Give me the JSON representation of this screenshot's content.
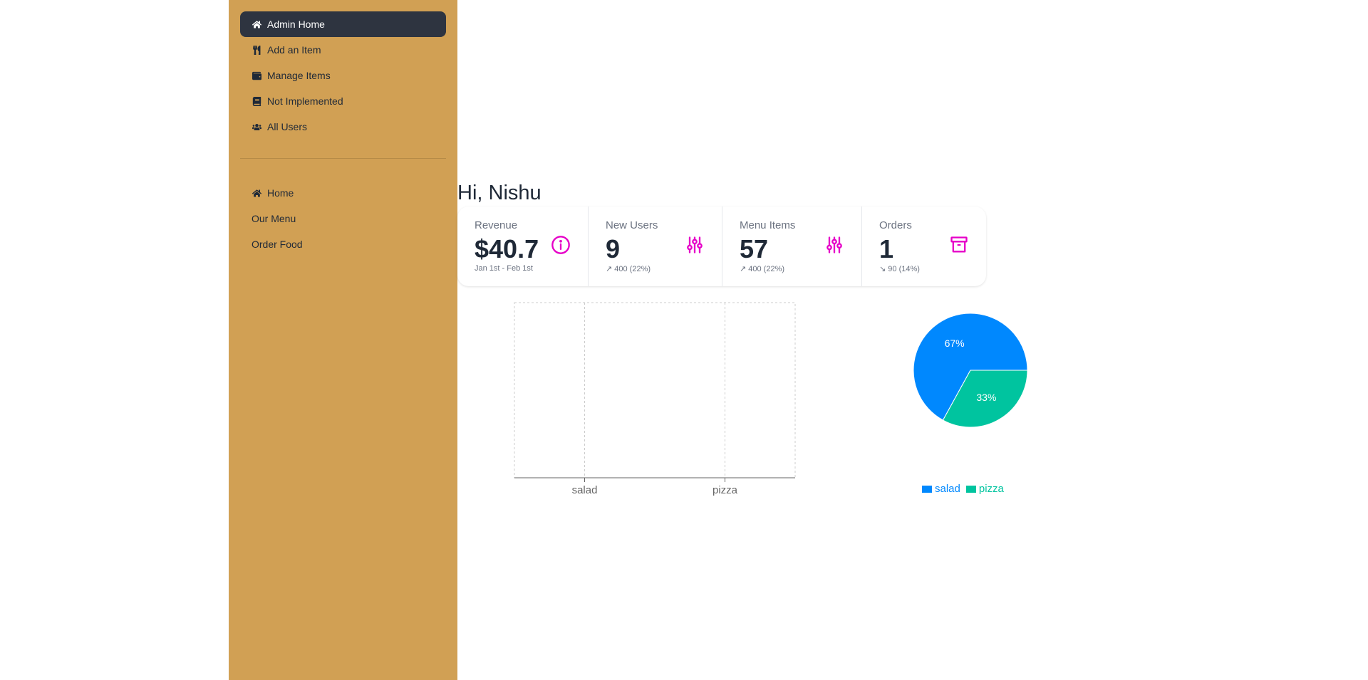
{
  "sidebar": {
    "admin_items": [
      {
        "label": "Admin Home",
        "icon": "home-icon",
        "active": true
      },
      {
        "label": "Add an Item",
        "icon": "utensils-icon",
        "active": false
      },
      {
        "label": "Manage Items",
        "icon": "wallet-icon",
        "active": false
      },
      {
        "label": "Not Implemented",
        "icon": "book-icon",
        "active": false
      },
      {
        "label": "All Users",
        "icon": "users-icon",
        "active": false
      }
    ],
    "main_items": [
      {
        "label": "Home",
        "icon": "home-icon"
      },
      {
        "label": "Our Menu",
        "icon": ""
      },
      {
        "label": "Order Food",
        "icon": ""
      }
    ]
  },
  "greeting": "Hi, Nishu",
  "stats": [
    {
      "title": "Revenue",
      "value": "$40.7",
      "desc": "Jan 1st - Feb 1st",
      "icon": "info-circle-icon"
    },
    {
      "title": "New Users",
      "value": "9",
      "desc": "↗︎ 400 (22%)",
      "icon": "sliders-icon"
    },
    {
      "title": "Menu Items",
      "value": "57",
      "desc": "↗︎ 400 (22%)",
      "icon": "sliders-icon"
    },
    {
      "title": "Orders",
      "value": "1",
      "desc": "↘︎ 90 (14%)",
      "icon": "archive-icon"
    }
  ],
  "colors": {
    "sidebar_bg": "#d1a054",
    "active_bg": "#2e3440",
    "accent": "#e600c8",
    "salad": "#0088fe",
    "pizza": "#00c49f"
  },
  "chart_data": [
    {
      "type": "bar",
      "categories": [
        "salad",
        "pizza"
      ],
      "values": [
        0,
        0
      ],
      "grid": true
    },
    {
      "type": "pie",
      "slices": [
        {
          "label": "salad",
          "value": 67,
          "display": "67%"
        },
        {
          "label": "pizza",
          "value": 33,
          "display": "33%"
        }
      ],
      "legend": "bottom"
    }
  ]
}
